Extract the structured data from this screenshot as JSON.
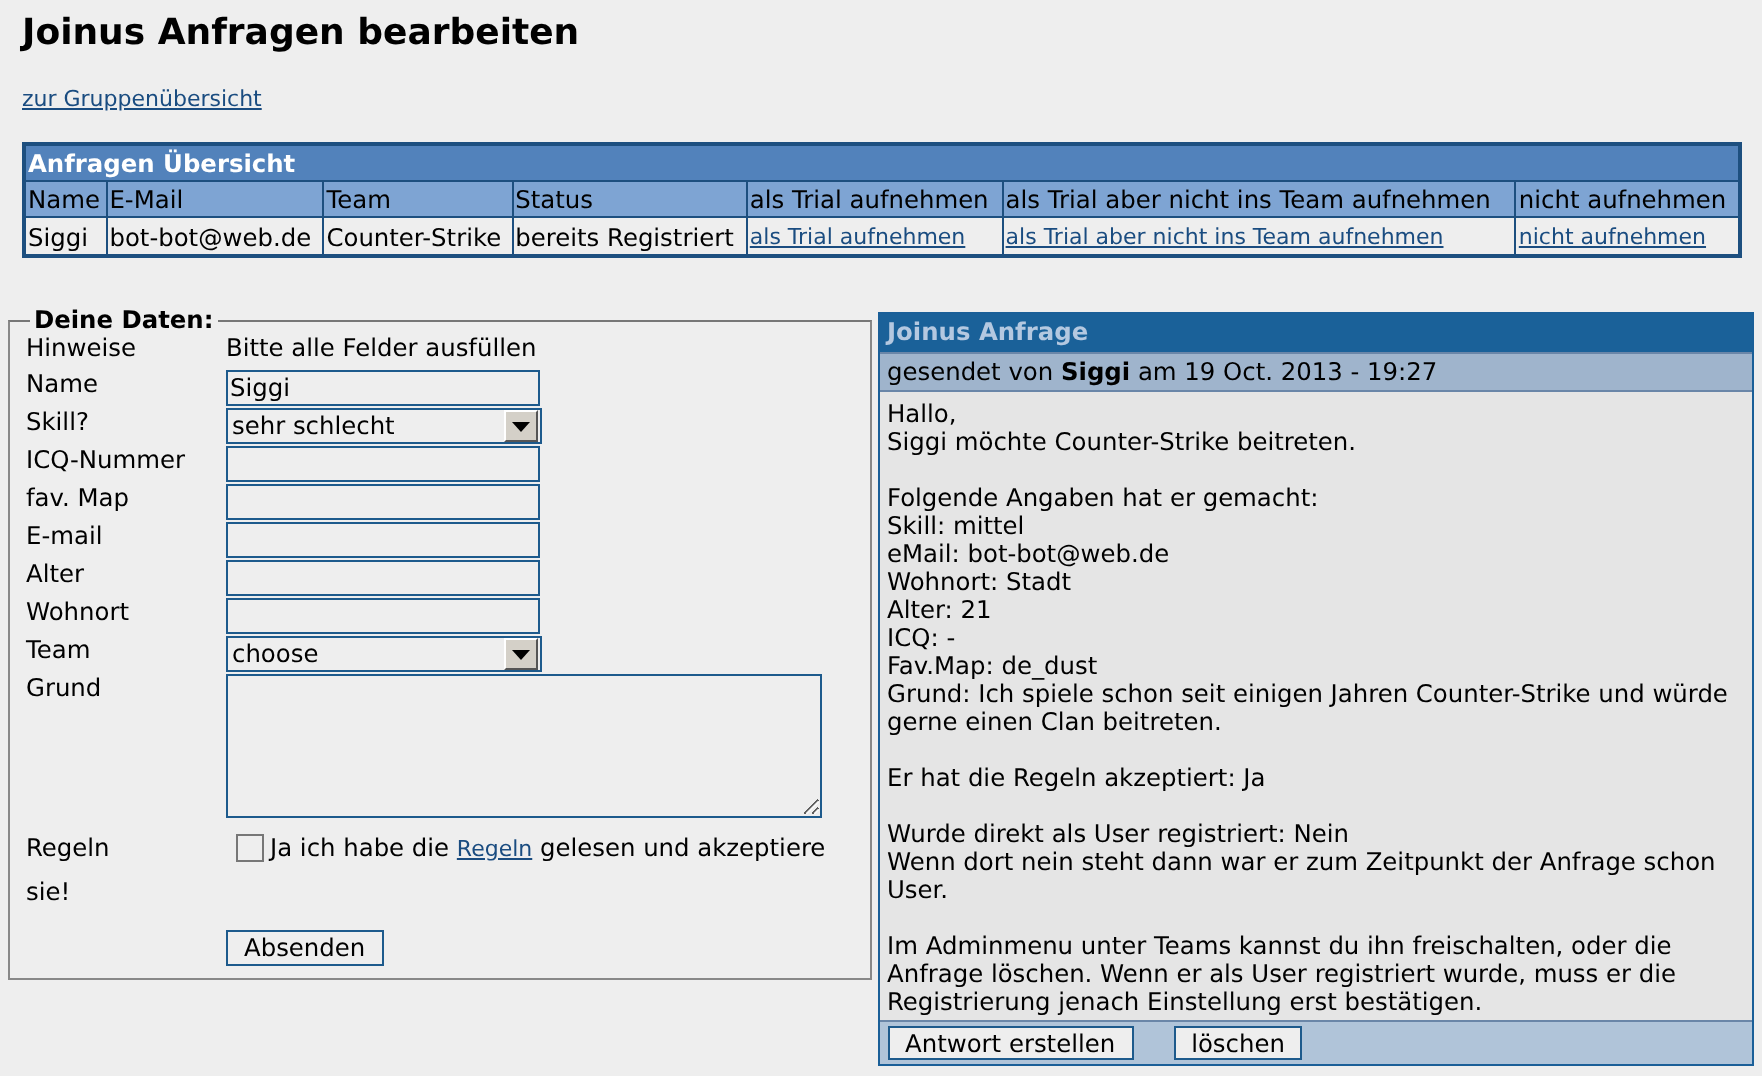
{
  "page": {
    "title": "Joinus Anfragen bearbeiten",
    "back_link": "zur Gruppenübersicht"
  },
  "overview": {
    "title": "Anfragen Übersicht",
    "columns": [
      "Name",
      "E-Mail",
      "Team",
      "Status",
      "als Trial aufnehmen",
      "als Trial aber nicht ins Team aufnehmen",
      "nicht aufnehmen"
    ],
    "rows": [
      {
        "cells": [
          {
            "kind": "text",
            "text": "Siggi"
          },
          {
            "kind": "text",
            "text": "bot-bot@web.de"
          },
          {
            "kind": "text",
            "text": "Counter-Strike"
          },
          {
            "kind": "text",
            "text": "bereits Registriert"
          },
          {
            "kind": "link",
            "text": "als Trial aufnehmen"
          },
          {
            "kind": "link",
            "text": "als Trial aber nicht ins Team aufnehmen"
          },
          {
            "kind": "link",
            "text": "nicht aufnehmen"
          }
        ]
      }
    ]
  },
  "form": {
    "legend": "Deine Daten:",
    "fields": [
      {
        "kind": "note",
        "label": "Hinweise",
        "text": "Bitte alle Felder ausfüllen"
      },
      {
        "kind": "text",
        "label": "Name",
        "value": "Siggi"
      },
      {
        "kind": "select",
        "label": "Skill?",
        "value": "sehr schlecht"
      },
      {
        "kind": "text",
        "label": "ICQ-Nummer"
      },
      {
        "kind": "text",
        "label": "fav. Map"
      },
      {
        "kind": "text",
        "label": "E-mail"
      },
      {
        "kind": "text",
        "label": "Alter"
      },
      {
        "kind": "text",
        "label": "Wohnort"
      },
      {
        "kind": "select",
        "label": "Team",
        "value": "choose"
      },
      {
        "kind": "textarea",
        "label": "Grund"
      },
      {
        "kind": "rules",
        "label": "Regeln",
        "checked": false,
        "before": "Ja ich habe die ",
        "link": "Regeln",
        "after": " gelesen und akzeptiere",
        "continuation": "sie!"
      }
    ],
    "submit": "Absenden"
  },
  "request": {
    "title": "Joinus Anfrage",
    "meta": "gesendet von **Siggi** am 19 Oct. 2013 - 19:27",
    "paragraphs": [
      [
        "Hallo,",
        "Siggi möchte Counter-Strike beitreten."
      ],
      [
        "Folgende Angaben hat er gemacht:",
        "Skill: mittel",
        "eMail: bot-bot@web.de",
        "Wohnort: Stadt",
        "Alter: 21",
        "ICQ: -",
        "Fav.Map: de_dust",
        "Grund: Ich spiele schon seit einigen Jahren Counter-Strike und würde gerne einen Clan beitreten."
      ],
      [
        "Er hat die Regeln akzeptiert: Ja"
      ],
      [
        "Wurde direkt als User registriert: Nein",
        "Wenn dort nein steht dann war er zum Zeitpunkt der Anfrage schon User."
      ],
      [
        "Im Adminmenu unter Teams kannst du ihn freischalten, oder die Anfrage löschen. Wenn er als User registriert wurde, muss er die Registrierung jenach Einstellung erst bestätigen."
      ]
    ],
    "buttons": [
      "Antwort erstellen",
      "löschen"
    ]
  }
}
